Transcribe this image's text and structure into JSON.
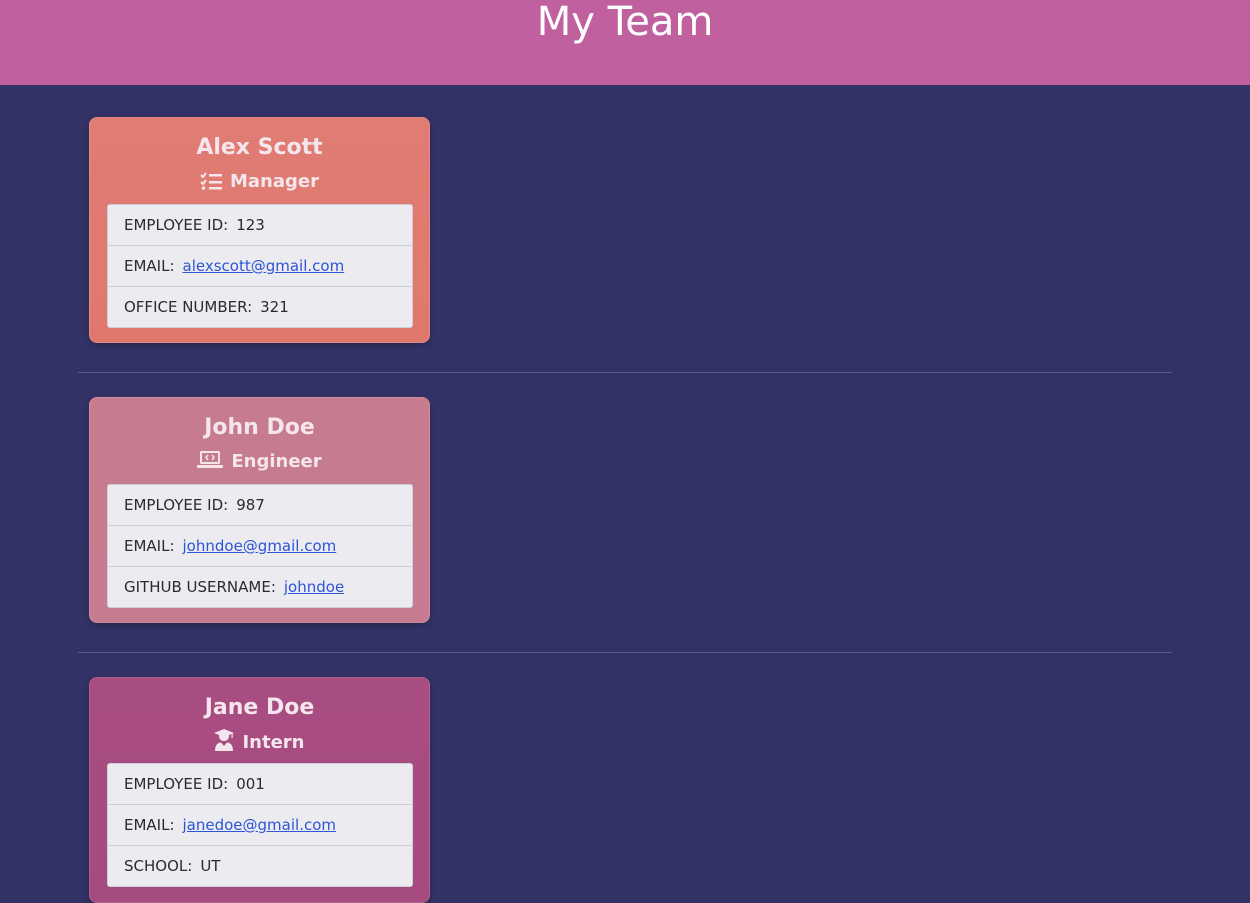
{
  "header": {
    "title": "My Team"
  },
  "colors": {
    "background": "#333266",
    "header": "#c0609e",
    "manager_card": "#e07c74",
    "engineer_card": "#c87b8f",
    "intern_card": "#a84d82",
    "link": "#2d55d6"
  },
  "cards": [
    {
      "name": "Alex Scott",
      "role": "Manager",
      "icon": "tasks-icon",
      "rows": [
        {
          "label": "EMPLOYEE ID:",
          "value": "123"
        },
        {
          "label": "EMAIL:",
          "value": "alexscott@gmail.com"
        },
        {
          "label": "OFFICE NUMBER:",
          "value": "321"
        }
      ]
    },
    {
      "name": "John Doe",
      "role": "Engineer",
      "icon": "laptop-code-icon",
      "rows": [
        {
          "label": "EMPLOYEE ID:",
          "value": "987"
        },
        {
          "label": "EMAIL:",
          "value": "johndoe@gmail.com"
        },
        {
          "label": "GITHUB USERNAME:",
          "value": "johndoe"
        }
      ]
    },
    {
      "name": "Jane Doe",
      "role": "Intern",
      "icon": "user-graduate-icon",
      "rows": [
        {
          "label": "EMPLOYEE ID:",
          "value": "001"
        },
        {
          "label": "EMAIL:",
          "value": "janedoe@gmail.com"
        },
        {
          "label": "SCHOOL:",
          "value": "UT"
        }
      ]
    }
  ]
}
